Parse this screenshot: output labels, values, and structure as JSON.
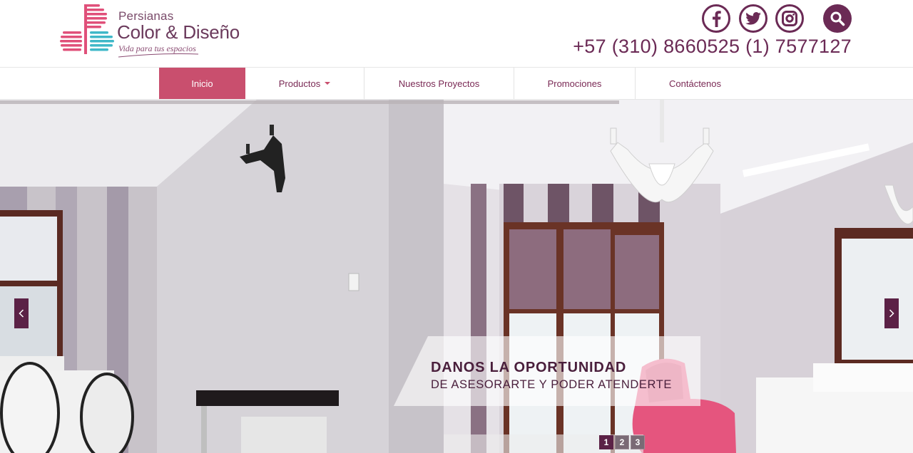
{
  "brand": {
    "name_small": "Persianas",
    "name_big": "Color & Diseño",
    "tagline": "Vida para tus espacios",
    "colors": {
      "pink": "#e0507a",
      "teal": "#3fb8c8",
      "plum": "#6b2a55"
    }
  },
  "header": {
    "phone": "+57 (310) 8660525 (1) 7577127",
    "socials": [
      {
        "icon": "facebook-icon"
      },
      {
        "icon": "twitter-icon"
      },
      {
        "icon": "instagram-icon"
      },
      {
        "icon": "search-icon"
      }
    ]
  },
  "nav": {
    "items": [
      {
        "label": "Inicio",
        "active": true
      },
      {
        "label": "Productos",
        "dropdown": true
      },
      {
        "label": "Nuestros Proyectos"
      },
      {
        "label": "Promociones"
      },
      {
        "label": "Contáctenos"
      }
    ],
    "active_color": "#c94f6e"
  },
  "slider": {
    "caption_title": "DANOS LA OPORTUNIDAD",
    "caption_sub": "DE ASESORARTE Y PODER ATENDERTE",
    "pages": [
      "1",
      "2",
      "3"
    ],
    "active_page": "1",
    "prev_icon": "chevron-left-icon",
    "next_icon": "chevron-right-icon"
  }
}
